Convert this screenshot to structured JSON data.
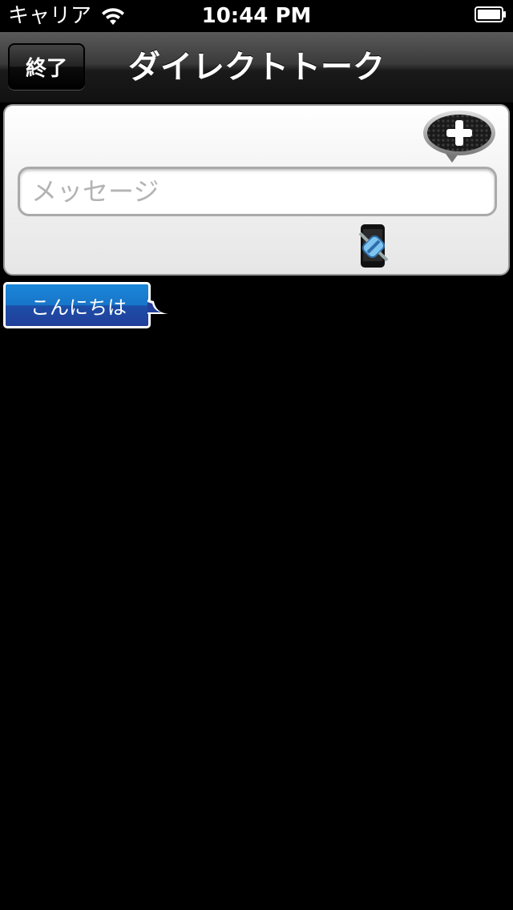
{
  "status_bar": {
    "carrier": "キャリア",
    "time": "10:44 PM",
    "wifi_icon": "wifi-icon",
    "battery_icon": "battery-icon"
  },
  "nav": {
    "back_label": "終了",
    "title": "ダイレクトトーク"
  },
  "compose": {
    "placeholder": "メッセージ",
    "value": "",
    "add_icon": "plus-speech-bubble-icon",
    "connect_icon": "phone-plug-icon"
  },
  "messages": [
    {
      "text": "こんにちは"
    }
  ],
  "colors": {
    "bubble_top": "#1a86d8",
    "bubble_bottom": "#223f9a",
    "nav_bar": "#2a2a2a"
  }
}
